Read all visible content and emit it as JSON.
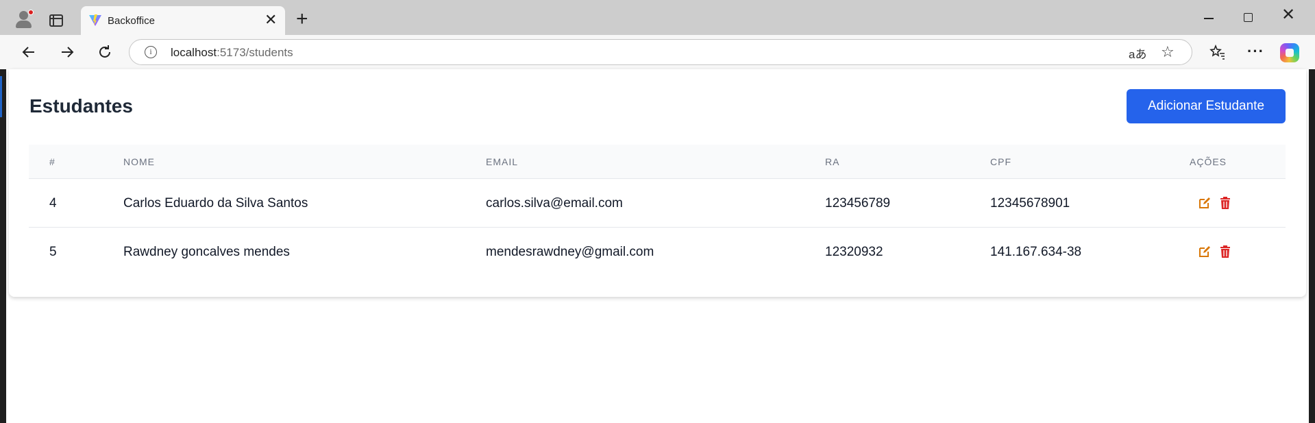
{
  "browser": {
    "tab_title": "Backoffice",
    "tab_close": "✕",
    "new_tab": "+",
    "url_host": "localhost",
    "url_rest": ":5173/students",
    "read_aloud": "aあ",
    "window_close": "✕"
  },
  "page": {
    "title": "Estudantes",
    "add_button": "Adicionar Estudante"
  },
  "table": {
    "headers": [
      "#",
      "NOME",
      "EMAIL",
      "RA",
      "CPF",
      "AÇÕES"
    ],
    "rows": [
      [
        "4",
        "Carlos Eduardo da Silva Santos",
        "carlos.silva@email.com",
        "123456789",
        "12345678901"
      ],
      [
        "5",
        "Rawdney goncalves mendes",
        "mendesrawdney@gmail.com",
        "12320932",
        "141.167.634-38"
      ]
    ]
  },
  "colors": {
    "primary": "#2563eb",
    "edit_icon": "#d97706",
    "delete_icon": "#dc2626"
  },
  "icons": [
    "profile-icon",
    "tabs-icon",
    "back-icon",
    "forward-icon",
    "reload-icon",
    "info-icon",
    "star-icon",
    "favorites-icon",
    "more-icon",
    "copilot-icon",
    "edit-icon",
    "trash-icon"
  ]
}
